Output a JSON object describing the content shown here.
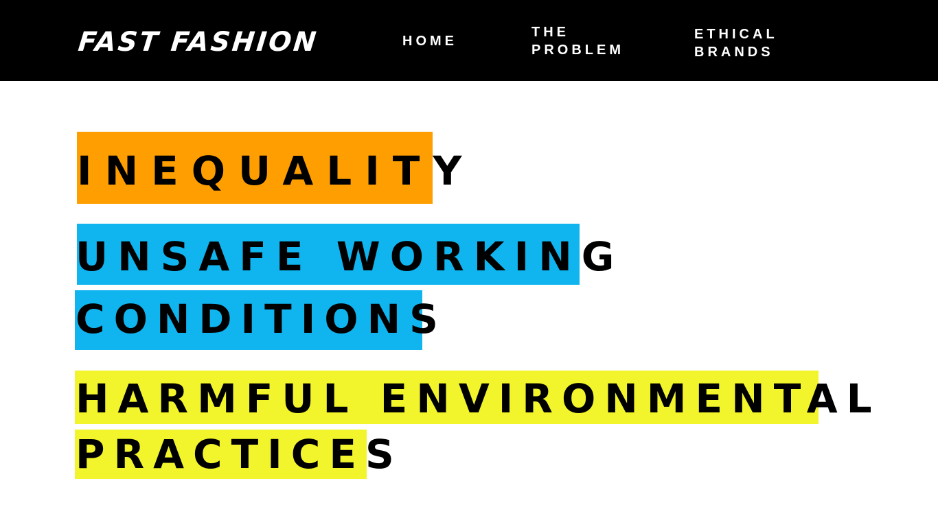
{
  "header": {
    "logo": "FAST FASHION",
    "nav": {
      "home": [
        "HOME"
      ],
      "the_problem": [
        "THE",
        "PROBLEM"
      ],
      "ethical_brands": [
        "ETHICAL",
        "BRANDS"
      ]
    }
  },
  "main": {
    "issues": [
      {
        "lines": [
          "INEQUALITY"
        ],
        "highlight_color": "#FF9E00"
      },
      {
        "lines": [
          "UNSAFE WORKING",
          "CONDITIONS"
        ],
        "highlight_color": "#10B4EE"
      },
      {
        "lines": [
          "HARMFUL ENVIRONMENTAL",
          "PRACTICES"
        ],
        "highlight_color": "#F2F52B"
      }
    ]
  },
  "colors": {
    "header_bg": "#000000",
    "header_text": "#FFFFFF",
    "page_bg": "#FFFFFF",
    "body_text": "#000000"
  }
}
